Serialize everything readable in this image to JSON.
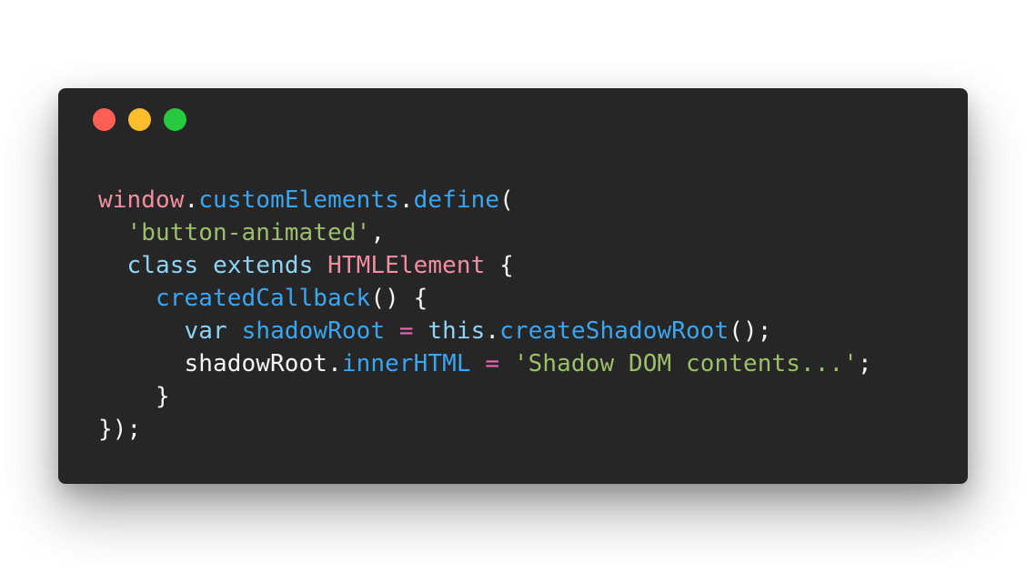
{
  "window_controls": {
    "close_color": "#ff5f56",
    "minimize_color": "#ffbd2e",
    "maximize_color": "#27c93f"
  },
  "colors": {
    "background": "#ffffff",
    "editor_background": "#262626",
    "plain": "#f5f5f5",
    "variable": "#f38d9f",
    "function": "#3aa6f2",
    "string": "#9dbf6b",
    "keyword": "#8ed4f7",
    "class_name": "#f38d9f",
    "operator": "#ef64b5"
  },
  "code": {
    "language": "javascript",
    "lines": [
      [
        {
          "text": "window",
          "type": "variable"
        },
        {
          "text": ".",
          "type": "plain"
        },
        {
          "text": "customElements",
          "type": "function"
        },
        {
          "text": ".",
          "type": "plain"
        },
        {
          "text": "define",
          "type": "function"
        },
        {
          "text": "(",
          "type": "plain"
        }
      ],
      [
        {
          "text": "  ",
          "type": "plain"
        },
        {
          "text": "'button-animated'",
          "type": "string"
        },
        {
          "text": ",",
          "type": "plain"
        }
      ],
      [
        {
          "text": "  ",
          "type": "plain"
        },
        {
          "text": "class",
          "type": "keyword"
        },
        {
          "text": " ",
          "type": "plain"
        },
        {
          "text": "extends",
          "type": "keyword"
        },
        {
          "text": " ",
          "type": "plain"
        },
        {
          "text": "HTMLElement",
          "type": "class_name"
        },
        {
          "text": " {",
          "type": "plain"
        }
      ],
      [
        {
          "text": "    ",
          "type": "plain"
        },
        {
          "text": "createdCallback",
          "type": "function"
        },
        {
          "text": "() {",
          "type": "plain"
        }
      ],
      [
        {
          "text": "      ",
          "type": "plain"
        },
        {
          "text": "var",
          "type": "keyword"
        },
        {
          "text": " ",
          "type": "plain"
        },
        {
          "text": "shadowRoot",
          "type": "function"
        },
        {
          "text": " ",
          "type": "plain"
        },
        {
          "text": "=",
          "type": "operator"
        },
        {
          "text": " ",
          "type": "plain"
        },
        {
          "text": "this",
          "type": "keyword"
        },
        {
          "text": ".",
          "type": "plain"
        },
        {
          "text": "createShadowRoot",
          "type": "function"
        },
        {
          "text": "();",
          "type": "plain"
        }
      ],
      [
        {
          "text": "      ",
          "type": "plain"
        },
        {
          "text": "shadowRoot",
          "type": "plain"
        },
        {
          "text": ".",
          "type": "plain"
        },
        {
          "text": "innerHTML",
          "type": "function"
        },
        {
          "text": " ",
          "type": "plain"
        },
        {
          "text": "=",
          "type": "operator"
        },
        {
          "text": " ",
          "type": "plain"
        },
        {
          "text": "'Shadow DOM contents...'",
          "type": "string"
        },
        {
          "text": ";",
          "type": "plain"
        }
      ],
      [
        {
          "text": "    }",
          "type": "plain"
        }
      ],
      [
        {
          "text": "});",
          "type": "plain"
        }
      ]
    ]
  }
}
